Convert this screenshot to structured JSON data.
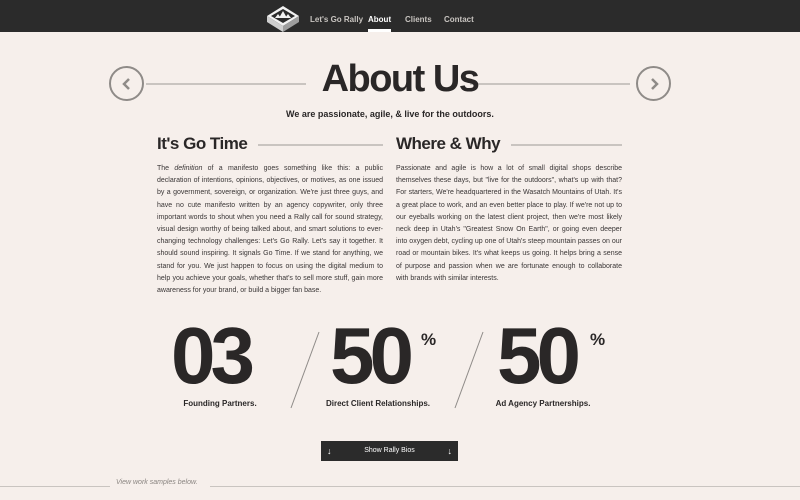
{
  "nav": {
    "items": [
      {
        "label": "Let's Go Rally",
        "active": false
      },
      {
        "label": "About",
        "active": true
      },
      {
        "label": "Clients",
        "active": false
      },
      {
        "label": "Contact",
        "active": false
      }
    ]
  },
  "hero": {
    "title": "About Us",
    "tagline": "We are passionate, agile, & live for the outdoors."
  },
  "columns": {
    "left": {
      "heading": "It's Go Time",
      "body": "The definition of a manifesto goes something like this: a public declaration of intentions, opinions, objectives, or motives, as one issued by a government, sovereign, or organization. We're just three guys, and have no cute manifesto written by an agency copywriter, only three important words to shout when you need a Rally call for sound strategy, visual design worthy of being talked about, and smart solutions to ever-changing technology challenges: Let's Go Rally. Let's say it together. It should sound inspiring. It signals Go Time. If we stand for anything, we stand for you. We just happen to focus on using the digital medium to help you achieve your goals, whether that's to sell more stuff, gain more awareness for your brand, or build a bigger fan base."
    },
    "right": {
      "heading": "Where & Why",
      "body": "Passionate and agile is how a lot of small digital shops describe themselves these days, but \"live for the outdoors\", what's up with that? For starters, We're headquartered in the Wasatch Mountains of Utah. It's a great place to work, and an even better place to play. If we're not up to our eyeballs working on the latest client project, then we're most likely neck deep in Utah's \"Greatest Snow On Earth\", or going even deeper into oxygen debt, cycling up one of Utah's steep mountain passes on our road or mountain bikes. It's what keeps us going. It helps bring a sense of purpose and passion when we are fortunate enough to collaborate with brands with similar interests."
    }
  },
  "stats": [
    {
      "value": "03",
      "suffix": "",
      "label": "Founding Partners."
    },
    {
      "value": "50",
      "suffix": "%",
      "label": "Direct Client Relationships."
    },
    {
      "value": "50",
      "suffix": "%",
      "label": "Ad Agency Partnerships."
    }
  ],
  "bios_button": {
    "label": "Show Rally Bios",
    "arrow": "↓"
  },
  "footer": {
    "label": "View work samples below."
  },
  "icons": {
    "prev": "chevron-left-icon",
    "next": "chevron-right-icon",
    "logo": "rally-logo-icon"
  },
  "colors": {
    "topbar": "#2b2b2b",
    "background": "#f6efeb",
    "text": "#2a2727",
    "rule": "#c9c4c0"
  }
}
